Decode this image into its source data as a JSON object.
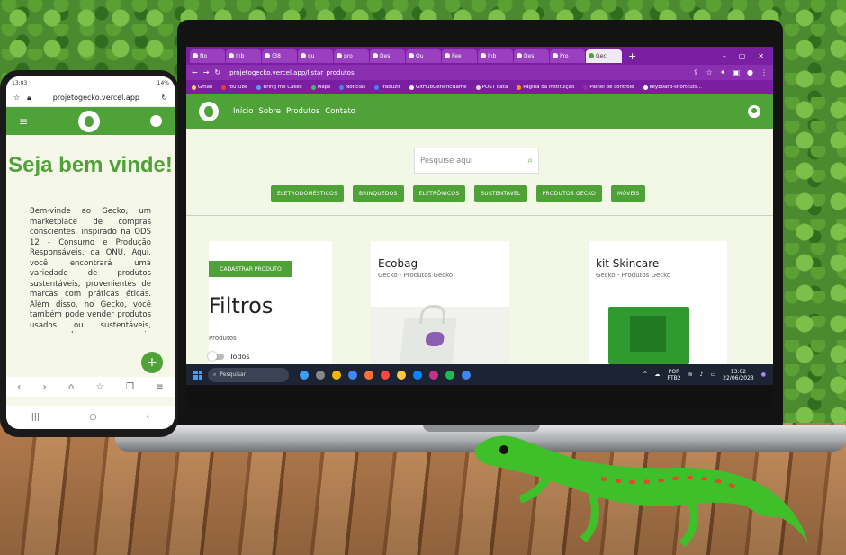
{
  "browser": {
    "tabs": [
      "No",
      "Inb",
      "(38",
      "qu",
      "pro",
      "Des",
      "Qu",
      "Fee",
      "Inb",
      "Des",
      "Pro",
      "Gec"
    ],
    "active_tab_index": 11,
    "new_tab": "+",
    "url": "projetogecko.vercel.app/listar_produtos",
    "bookmarks": [
      "Gmail",
      "YouTube",
      "Bring me Cakes",
      "Maps",
      "Notícias",
      "Traduzir",
      "GitHubGenericName",
      "POST data",
      "Página da instituição",
      "Painel de controle",
      "keyboard-shortcuts..."
    ]
  },
  "site": {
    "nav": [
      "Início",
      "Sobre",
      "Produtos",
      "Contato"
    ],
    "search_placeholder": "Pesquise aqui",
    "categories": [
      "ELETRODOMÉSTICOS",
      "BRINQUEDOS",
      "ELETRÔNICOS",
      "SUSTENTÁVEL",
      "PRODUTOS GECKO",
      "MÓVEIS"
    ],
    "add_product": "CADASTRAR PRODUTO",
    "filters_title": "Filtros",
    "filters_sub": "Produtos",
    "filter_all": "Todos",
    "products": [
      {
        "name": "Ecobag",
        "brand": "Gecko - Produtos Gecko"
      },
      {
        "name": "kit Skincare",
        "brand": "Gecko - Produtos Gecko"
      }
    ]
  },
  "taskbar": {
    "search": "Pesquisar",
    "lang": "POR",
    "layout": "PTB2",
    "time": "13:02",
    "date": "22/06/2023"
  },
  "phone": {
    "status_time": "13:03",
    "battery": "14%",
    "url": "projetogecko.vercel.app",
    "title": "Seja bem vinde!",
    "text": "Bem-vinde ao Gecko, um marketplace de compras conscientes, inspirado na ODS 12 - Consumo e Produção Responsáveis, da ONU. Aqui, você encontrará uma variedade de produtos sustentáveis, provenientes de marcas com práticas éticas. Além disso, no Gecko, você também pode vender produtos usados ou sustentáveis, promovendo a economia circular e",
    "fab": "+"
  },
  "colors": {
    "brand_green": "#4fa238",
    "browser_purple": "#7b1fa2"
  }
}
